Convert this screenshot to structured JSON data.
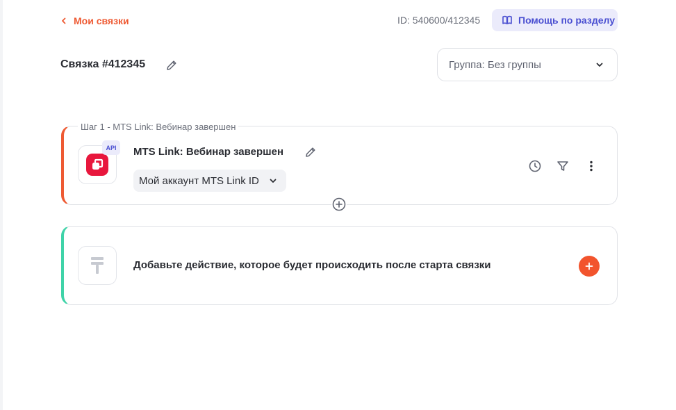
{
  "header": {
    "back_label": "Мои связки",
    "id_text": "ID: 540600/412345",
    "help_label": "Помощь по разделу"
  },
  "title": {
    "text": "Связка #412345"
  },
  "group_select": {
    "value": "Группа: Без группы"
  },
  "step": {
    "legend": "Шаг 1 - MTS Link: Вебинар завершен",
    "title": "MTS Link: Вебинар завершен",
    "badge": "API",
    "account": "Мой аккаунт MTS Link ID"
  },
  "add_action": {
    "text": "Добавьте действие, которое будет происходить после старта связки"
  },
  "colors": {
    "accent": "#ee5a33",
    "step_bar": "#ee5a33",
    "action_bar": "#3fd3a8",
    "help_bg": "#ebebfb",
    "help_text": "#4a4fd1",
    "app_logo": "#e8173d"
  },
  "icons": [
    "chevron-left-icon",
    "book-icon",
    "pencil-icon",
    "chevron-down-icon",
    "mts-link-logo-icon",
    "clock-icon",
    "filter-icon",
    "more-vertical-icon",
    "plus-circle-icon",
    "action-placeholder-icon",
    "plus-icon"
  ]
}
